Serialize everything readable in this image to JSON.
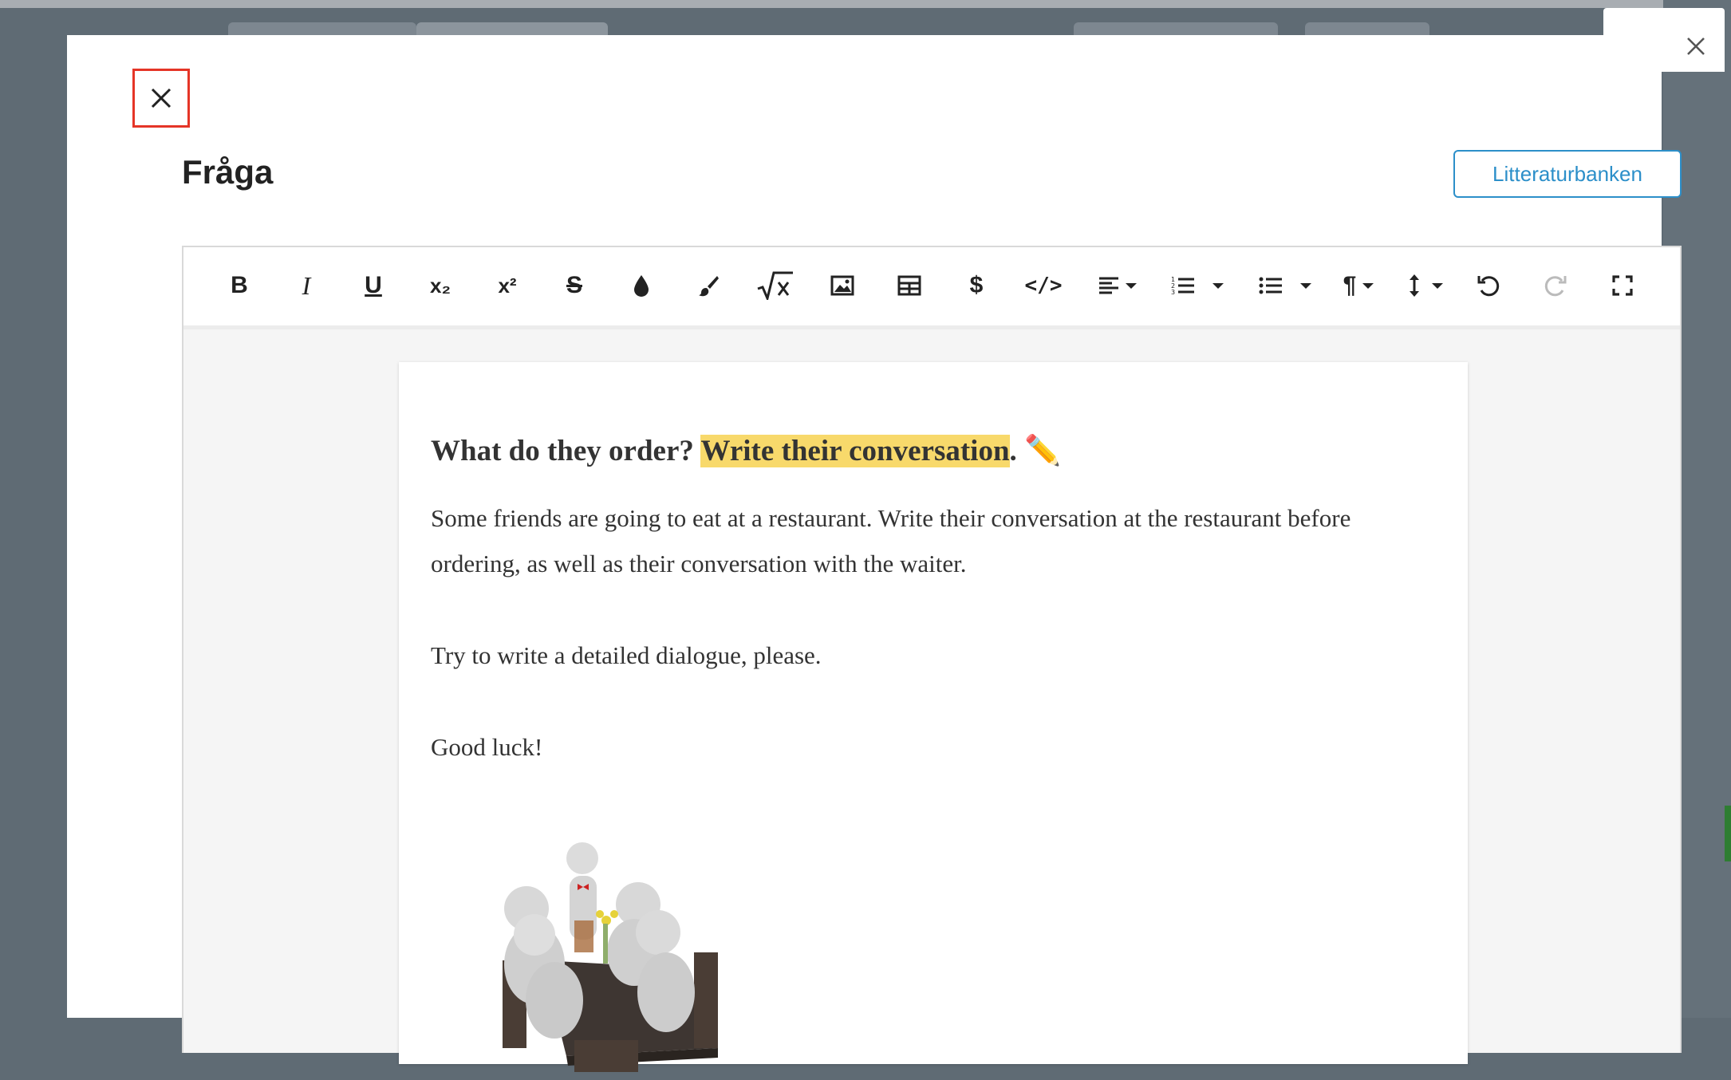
{
  "modal": {
    "title": "Fråga",
    "literature_button": "Litteraturbanken"
  },
  "toolbar": {
    "buttons": [
      {
        "name": "bold-icon",
        "label": "B"
      },
      {
        "name": "italic-icon",
        "label": "I"
      },
      {
        "name": "underline-icon",
        "label": "U"
      },
      {
        "name": "subscript-icon",
        "label": "x₂"
      },
      {
        "name": "superscript-icon",
        "label": "x²"
      },
      {
        "name": "strikethrough-icon",
        "label": "S"
      },
      {
        "name": "text-color-icon"
      },
      {
        "name": "background-color-icon"
      },
      {
        "name": "math-icon"
      },
      {
        "name": "image-icon"
      },
      {
        "name": "table-icon"
      },
      {
        "name": "special-characters-icon",
        "label": "$"
      },
      {
        "name": "code-view-icon",
        "label": "</>"
      },
      {
        "name": "align-icon"
      },
      {
        "name": "ordered-list-icon"
      },
      {
        "name": "unordered-list-icon"
      },
      {
        "name": "paragraph-format-icon",
        "label": "¶"
      },
      {
        "name": "line-height-icon"
      },
      {
        "name": "undo-icon"
      },
      {
        "name": "redo-icon"
      },
      {
        "name": "fullscreen-icon"
      }
    ]
  },
  "content": {
    "heading_start": "What do they order? ",
    "heading_highlight": "Write their conversation",
    "heading_end": ". ✏️",
    "paragraph_1": "Some friends are going to eat at a restaurant. Write their conversation at the restaurant before ordering, as well as their conversation with the waiter.",
    "paragraph_2": "Try to write a detailed dialogue, please.",
    "paragraph_3": "Good luck!"
  },
  "colors": {
    "highlight": "#f8d96b",
    "accent": "#2c8fc9",
    "close_outline": "#e53527"
  }
}
